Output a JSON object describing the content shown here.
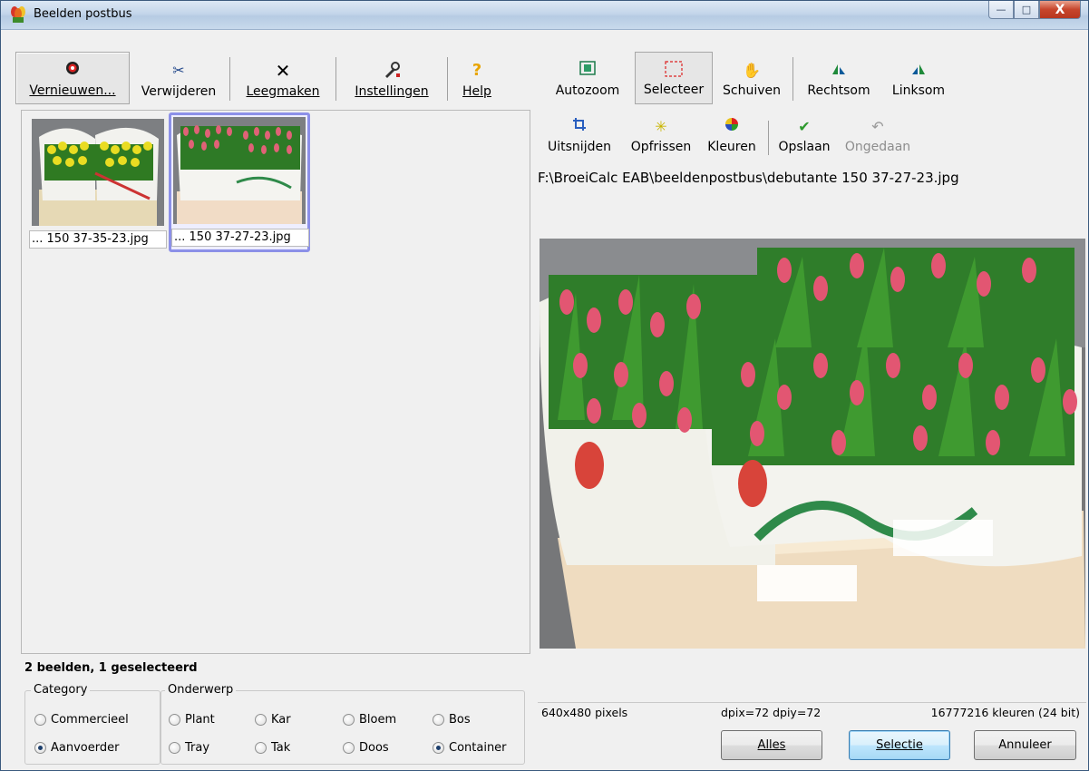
{
  "window": {
    "title": "Beelden postbus",
    "buttons": {
      "minimize": "—",
      "maximize": "□",
      "close": "X"
    }
  },
  "toolbar_left": {
    "items": [
      {
        "label": "Vernieuwen...",
        "icon": "refresh-icon",
        "pressed": true
      },
      {
        "label": "Verwijderen",
        "icon": "scissors-icon"
      },
      {
        "label": "Leegmaken",
        "icon": "x-icon"
      },
      {
        "label": "Instellingen",
        "icon": "settings-icon"
      },
      {
        "label": "Help",
        "icon": "help-icon"
      }
    ]
  },
  "thumbnails": [
    {
      "caption": "... 150 37-35-23.jpg",
      "selected": false
    },
    {
      "caption": "... 150 37-27-23.jpg",
      "selected": true
    }
  ],
  "status_left": "2 beelden, 1 geselecteerd",
  "category": {
    "legend": "Category",
    "options": [
      {
        "label": "Commercieel",
        "checked": false
      },
      {
        "label": "Aanvoerder",
        "checked": true
      }
    ]
  },
  "onderwerp": {
    "legend": "Onderwerp",
    "options": [
      {
        "label": "Plant",
        "checked": false
      },
      {
        "label": "Kar",
        "checked": false
      },
      {
        "label": "Bloem",
        "checked": false
      },
      {
        "label": "Bos",
        "checked": false
      },
      {
        "label": "Tray",
        "checked": false
      },
      {
        "label": "Tak",
        "checked": false
      },
      {
        "label": "Doos",
        "checked": false
      },
      {
        "label": "Container",
        "checked": true
      }
    ]
  },
  "toolbar_right1": {
    "items": [
      {
        "label": "Autozoom",
        "icon": "autozoom-icon"
      },
      {
        "label": "Selecteer",
        "icon": "select-icon",
        "pressed": true
      },
      {
        "label": "Schuiven",
        "icon": "hand-icon"
      },
      {
        "label": "Rechtsom",
        "icon": "rotate-right-icon"
      },
      {
        "label": "Linksom",
        "icon": "rotate-left-icon"
      }
    ]
  },
  "toolbar_right2": {
    "items": [
      {
        "label": "Uitsnijden",
        "icon": "crop-icon"
      },
      {
        "label": "Opfrissen",
        "icon": "sparkle-icon"
      },
      {
        "label": "Kleuren",
        "icon": "color-wheel-icon"
      },
      {
        "label": "Opslaan",
        "icon": "check-icon"
      },
      {
        "label": "Ongedaan",
        "icon": "undo-icon",
        "disabled": true
      }
    ]
  },
  "filepath": "F:\\BroeiCalc EAB\\beeldenpostbus\\debutante 150 37-27-23.jpg",
  "image_info": {
    "size": "640x480 pixels",
    "dpi": "dpix=72 dpiy=72",
    "colors": "16777216 kleuren (24 bit)"
  },
  "actions": {
    "alles": "Alles",
    "selectie": "Selectie",
    "annuleer": "Annuleer"
  }
}
